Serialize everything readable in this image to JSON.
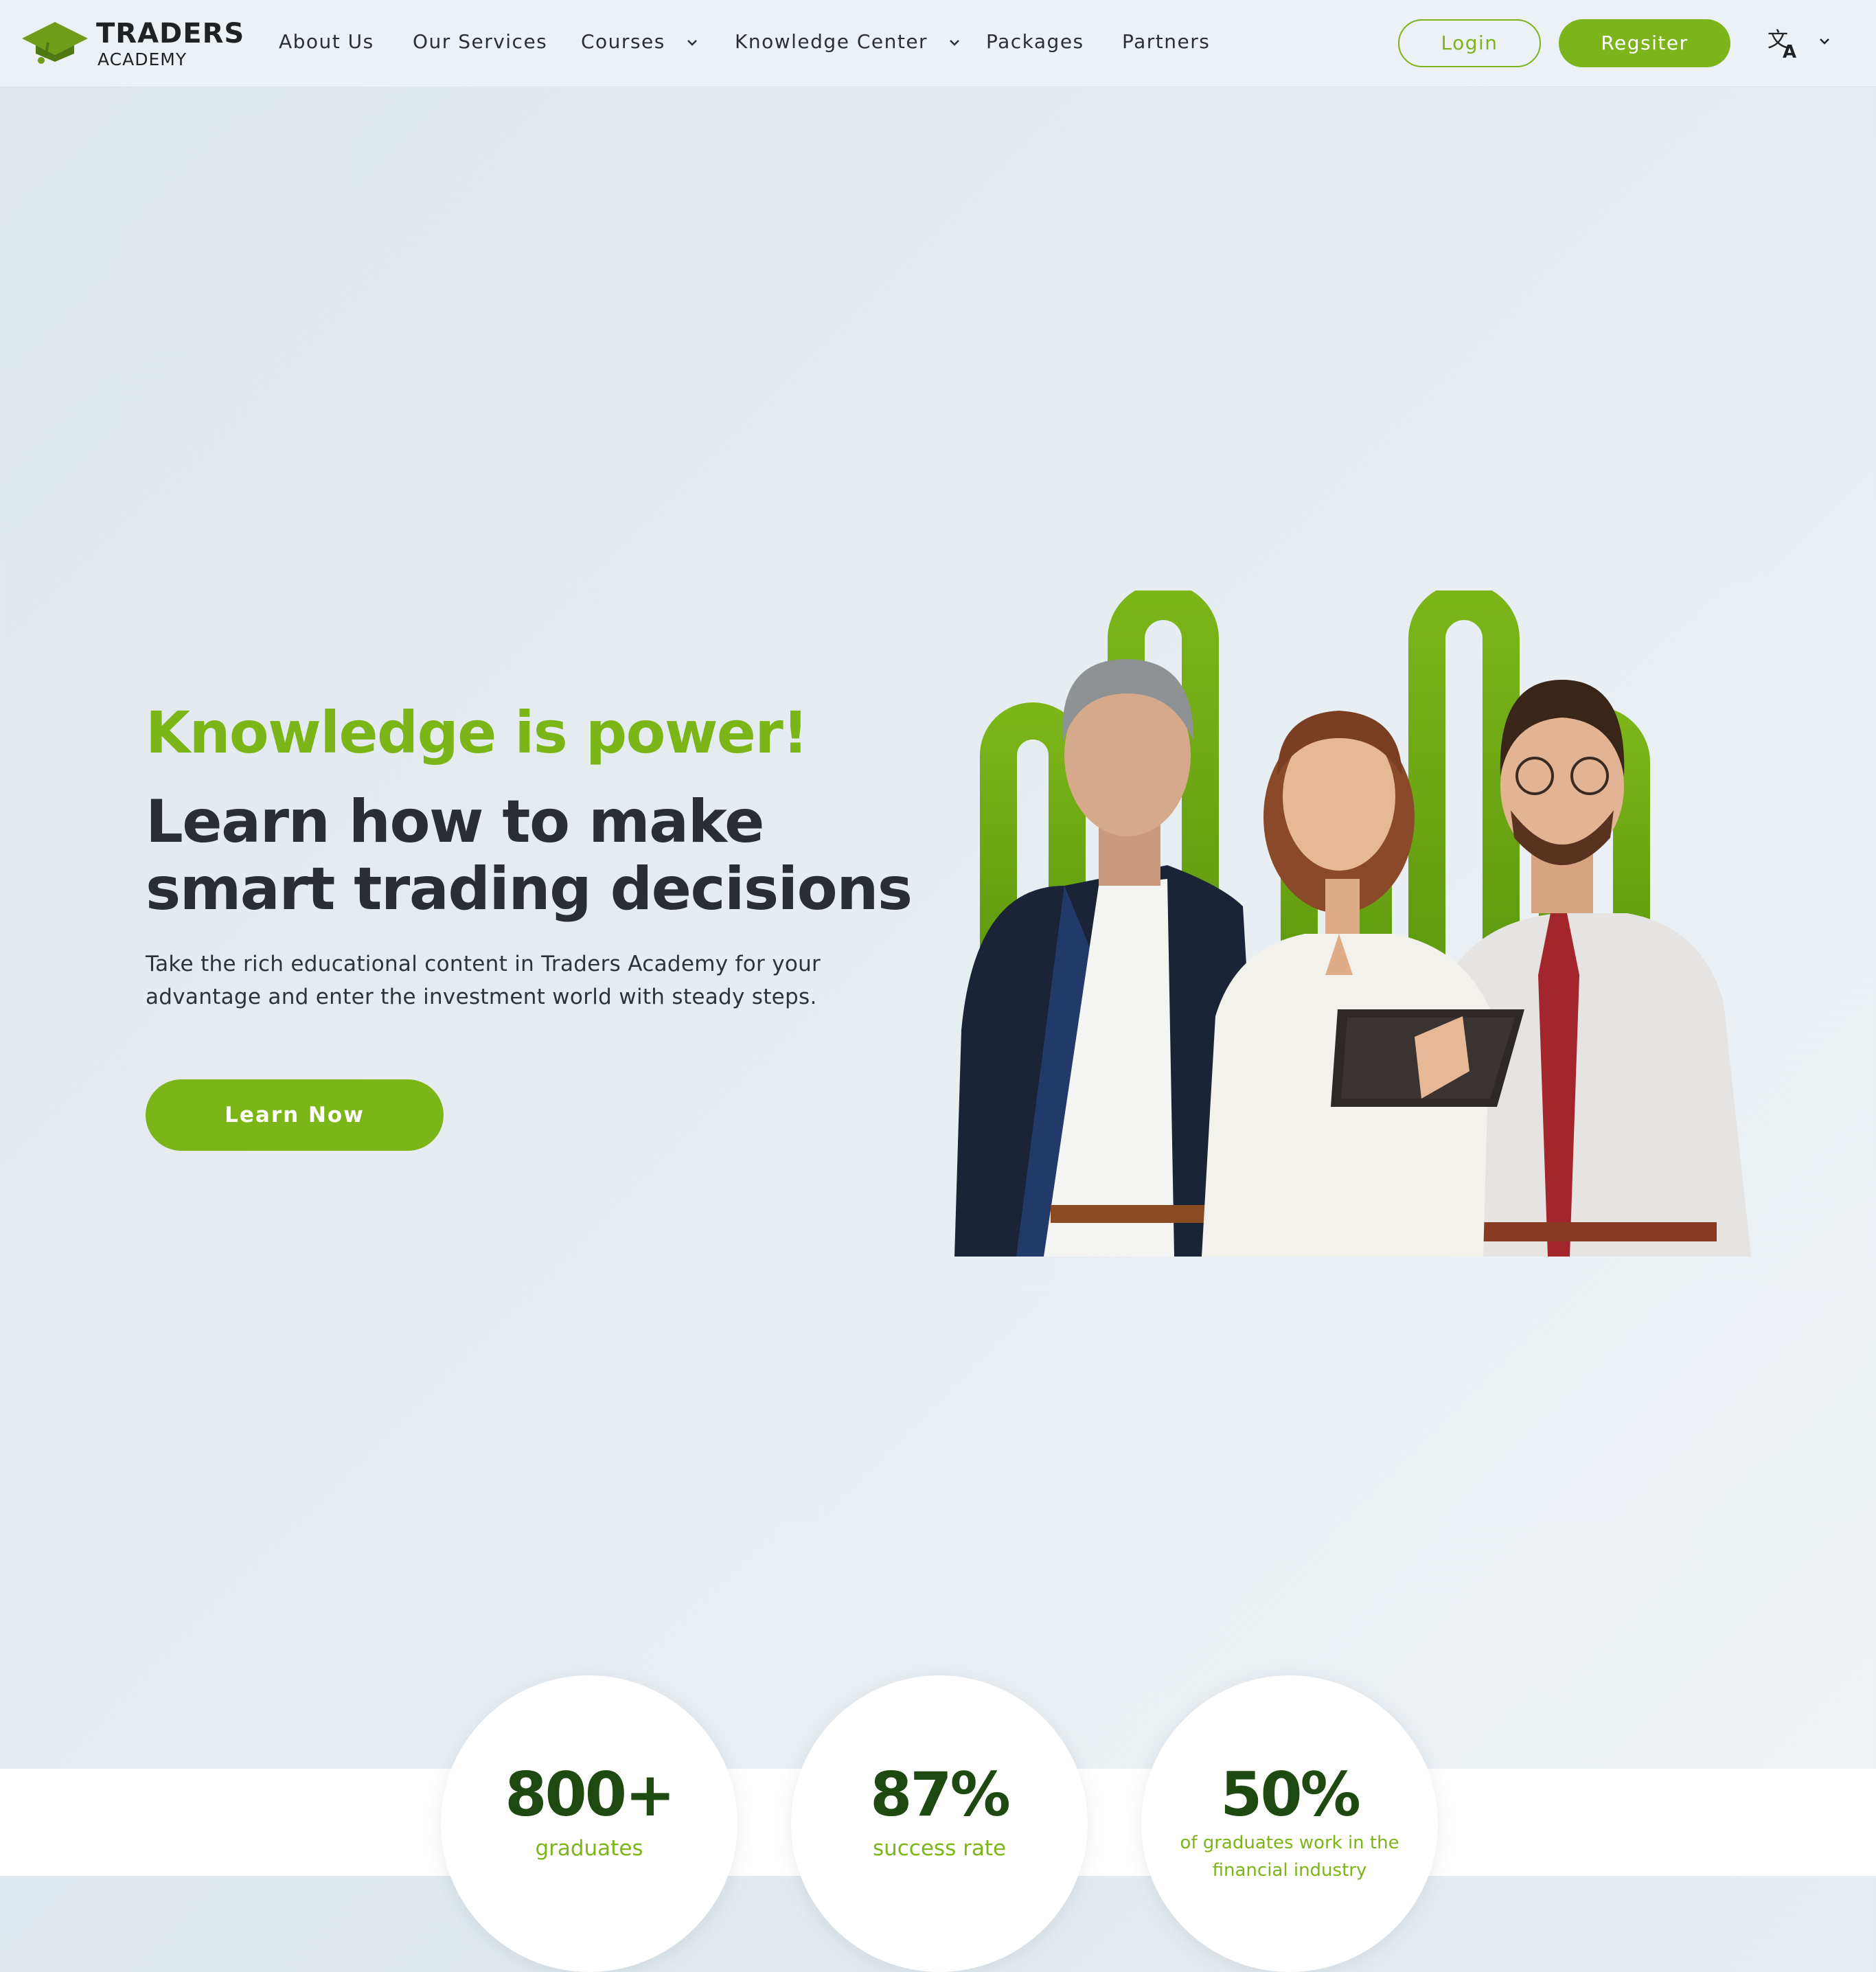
{
  "brand": {
    "name": "TRADERS",
    "sub": "ACADEMY",
    "accent_color": "#7cb518",
    "dark_green": "#1e4a12"
  },
  "nav": {
    "items": [
      {
        "label": "About Us",
        "has_dropdown": false
      },
      {
        "label": "Our Services",
        "has_dropdown": false
      },
      {
        "label": "Courses",
        "has_dropdown": true
      },
      {
        "label": "Knowledge Center",
        "has_dropdown": true
      },
      {
        "label": "Packages",
        "has_dropdown": false
      },
      {
        "label": "Partners",
        "has_dropdown": false
      }
    ],
    "login_label": "Login",
    "register_label": "Regsiter",
    "language_icon": "translate-icon"
  },
  "hero": {
    "kicker": "Knowledge is power!",
    "title": "Learn how to make smart trading decisions",
    "description": "Take the rich educational content in Traders Academy for your advantage and enter the investment world with steady steps.",
    "cta_label": "Learn Now",
    "image": "three-professionals-with-tablet"
  },
  "stats": [
    {
      "value": "800+",
      "label": "graduates"
    },
    {
      "value": "87%",
      "label": "success rate"
    },
    {
      "value": "50%",
      "label": "of graduates work in the financial industry"
    }
  ]
}
